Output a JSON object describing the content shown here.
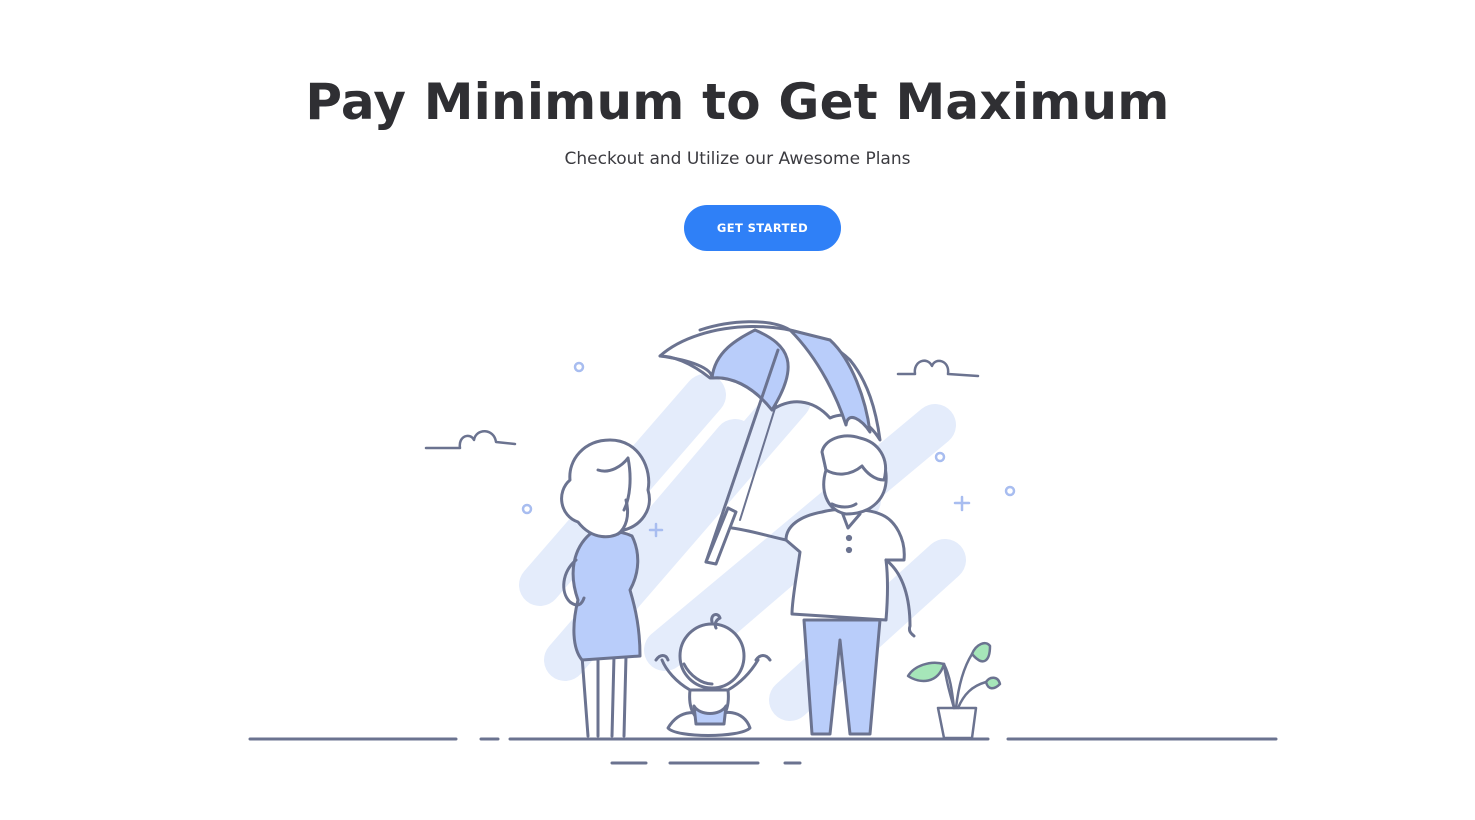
{
  "hero": {
    "title": "Pay Minimum to Get Maximum",
    "subtitle": "Checkout and Utilize our Awesome Plans",
    "cta_label": "GET STARTED"
  },
  "colors": {
    "accent": "#2f80f7",
    "heading": "#2f2f33",
    "line": "#6b7390",
    "soft_blue": "#e3ebfb",
    "fill_blue": "#b9cdfa",
    "plant_green": "#a6e6b9"
  },
  "illustration": {
    "subject": "family-under-umbrella",
    "icons": [
      "umbrella-icon",
      "cloud-icon",
      "plant-icon"
    ]
  }
}
